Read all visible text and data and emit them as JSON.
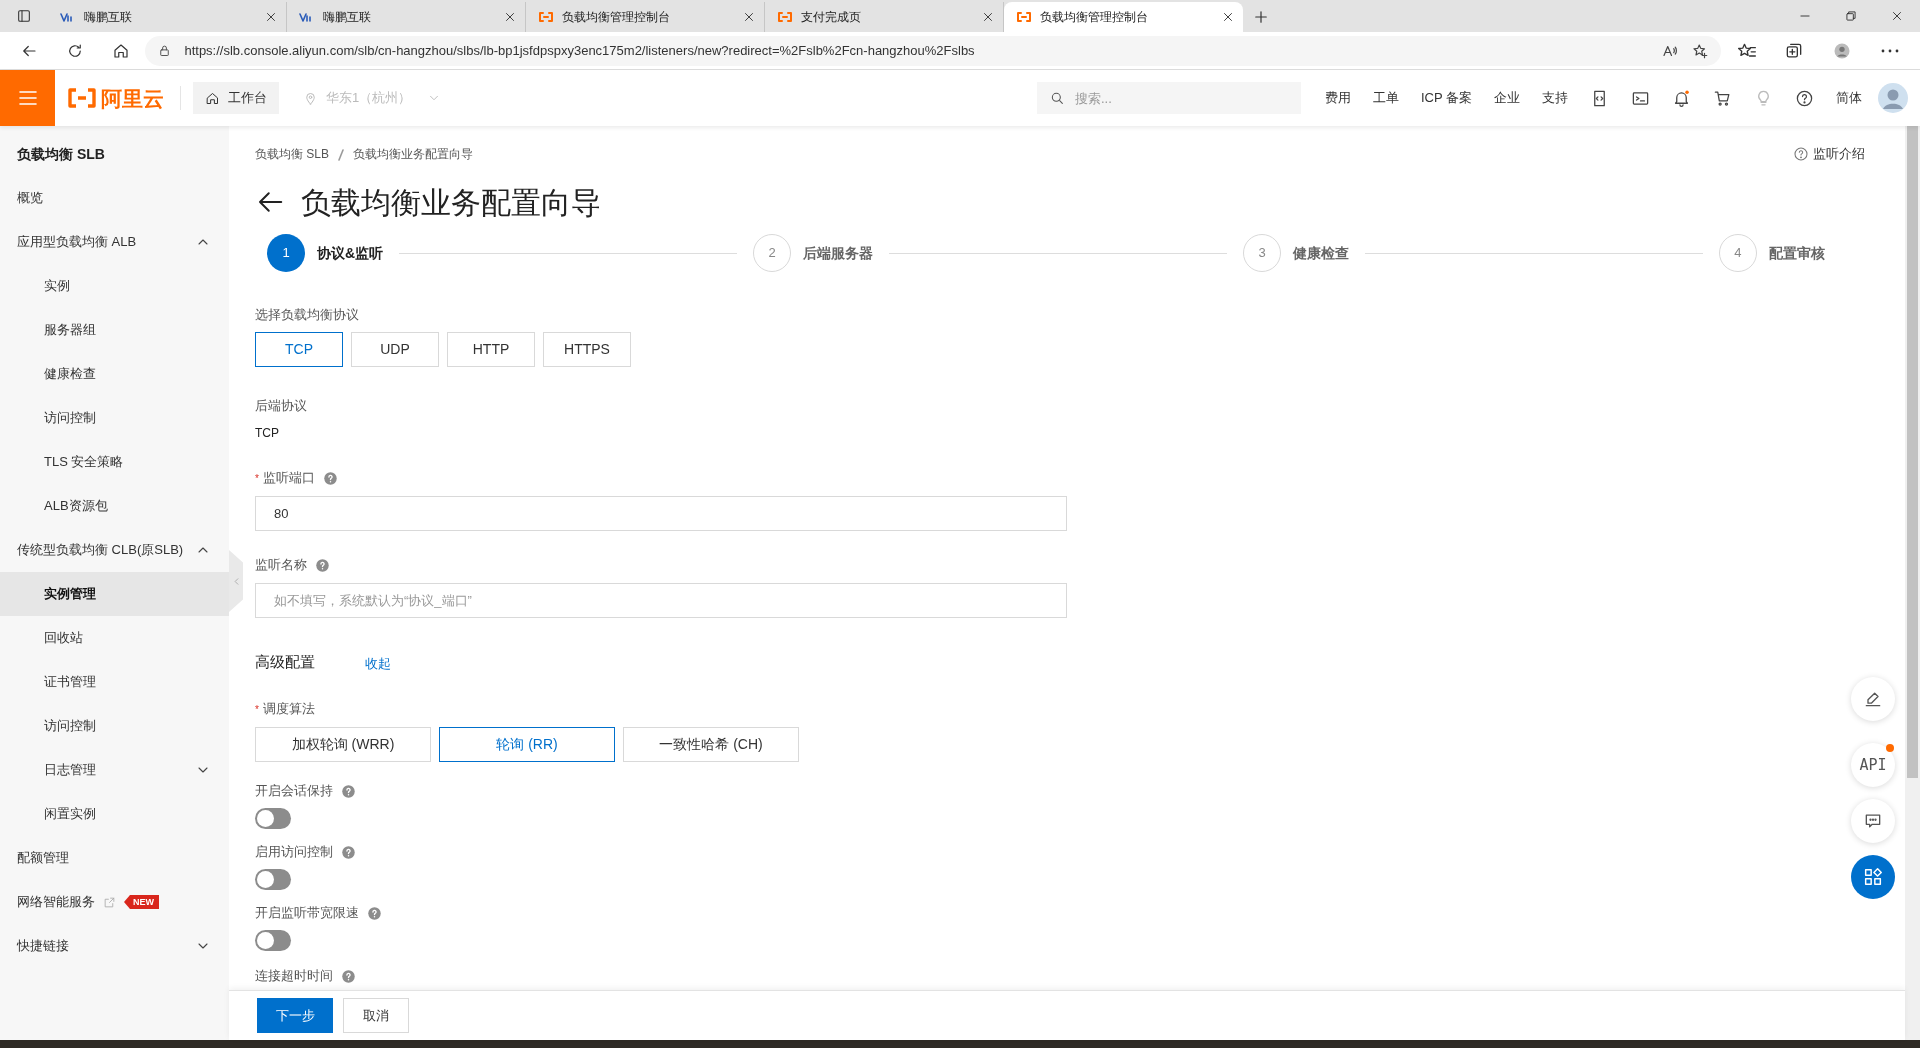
{
  "browser": {
    "tabs": [
      {
        "title": "嗨鹏互联",
        "kind": "site",
        "selected": false
      },
      {
        "title": "嗨鹏互联",
        "kind": "site",
        "selected": false
      },
      {
        "title": "负载均衡管理控制台",
        "kind": "cloud",
        "selected": false
      },
      {
        "title": "支付完成页",
        "kind": "cloud",
        "selected": false
      },
      {
        "title": "负载均衡管理控制台",
        "kind": "cloud",
        "selected": true
      }
    ],
    "url": "https://slb.console.aliyun.com/slb/cn-hangzhou/slbs/lb-bp1jsfdpspxy3enc175m2/listeners/new?redirect=%2Fslb%2Fcn-hangzhou%2Fslbs"
  },
  "header": {
    "logo": "阿里云",
    "workbench": "工作台",
    "region": {
      "label": "华东1（杭州）",
      "disabled": true
    },
    "search_placeholder": "搜索...",
    "nav": [
      "费用",
      "工单",
      "ICP 备案",
      "企业",
      "支持"
    ],
    "language": "简体"
  },
  "sidebar": {
    "title": "负载均衡 SLB",
    "items": [
      {
        "label": "概览",
        "selected": false
      },
      {
        "label": "应用型负载均衡 ALB",
        "selected": false,
        "expanded": true,
        "children": [
          {
            "label": "实例",
            "selected": false
          },
          {
            "label": "服务器组",
            "selected": false
          },
          {
            "label": "健康检查",
            "selected": false
          },
          {
            "label": "访问控制",
            "selected": false
          },
          {
            "label": "TLS 安全策略",
            "selected": false
          },
          {
            "label": "ALB资源包",
            "selected": false
          }
        ]
      },
      {
        "label": "传统型负载均衡 CLB(原SLB)",
        "selected": false,
        "expanded": true,
        "children": [
          {
            "label": "实例管理",
            "selected": true
          },
          {
            "label": "回收站",
            "selected": false
          },
          {
            "label": "证书管理",
            "selected": false
          },
          {
            "label": "访问控制",
            "selected": false
          },
          {
            "label": "日志管理",
            "selected": false,
            "expanded": false
          },
          {
            "label": "闲置实例",
            "selected": false
          }
        ]
      },
      {
        "label": "配额管理",
        "selected": false
      },
      {
        "label": "网络智能服务",
        "selected": false,
        "external": true,
        "badge": "NEW"
      },
      {
        "label": "快捷链接",
        "selected": false,
        "expanded": false
      }
    ]
  },
  "breadcrumb": [
    "负载均衡 SLB",
    "负载均衡业务配置向导"
  ],
  "help_link": "监听介绍",
  "title": "负载均衡业务配置向导",
  "steps": [
    {
      "number": "1",
      "label": "协议&监听",
      "selected": true
    },
    {
      "number": "2",
      "label": "后端服务器",
      "selected": false
    },
    {
      "number": "3",
      "label": "健康检查",
      "selected": false
    },
    {
      "number": "4",
      "label": "配置审核",
      "selected": false
    }
  ],
  "form": {
    "protocol": {
      "label": "选择负载均衡协议",
      "options": [
        {
          "label": "TCP",
          "selected": true
        },
        {
          "label": "UDP",
          "selected": false
        },
        {
          "label": "HTTP",
          "selected": false
        },
        {
          "label": "HTTPS",
          "selected": false
        }
      ]
    },
    "backend_protocol": {
      "label": "后端协议",
      "value": "TCP"
    },
    "port": {
      "required_mark": "*",
      "label": "监听端口",
      "value": "80"
    },
    "name": {
      "label": "监听名称",
      "placeholder": "如不填写，系统默认为“协议_端口”"
    },
    "advanced": {
      "label": "高级配置",
      "toggle": "收起"
    },
    "algorithm": {
      "required_mark": "*",
      "label": "调度算法",
      "options": [
        {
          "label": "加权轮询 (WRR)",
          "selected": false
        },
        {
          "label": "轮询 (RR)",
          "selected": true
        },
        {
          "label": "一致性哈希 (CH)",
          "selected": false
        }
      ]
    },
    "switches": [
      {
        "label": "开启会话保持",
        "on": false
      },
      {
        "label": "启用访问控制",
        "on": false
      },
      {
        "label": "开启监听带宽限速",
        "on": false
      }
    ],
    "next_label": "连接超时时间"
  },
  "footer": {
    "buttons": [
      {
        "label": "下一步",
        "kind": "primary"
      },
      {
        "label": "取消",
        "kind": "normal"
      }
    ]
  },
  "float_tools": [
    {
      "kind": "edit"
    },
    {
      "kind": "api",
      "label": "API"
    },
    {
      "kind": "chat"
    },
    {
      "kind": "apps"
    }
  ]
}
